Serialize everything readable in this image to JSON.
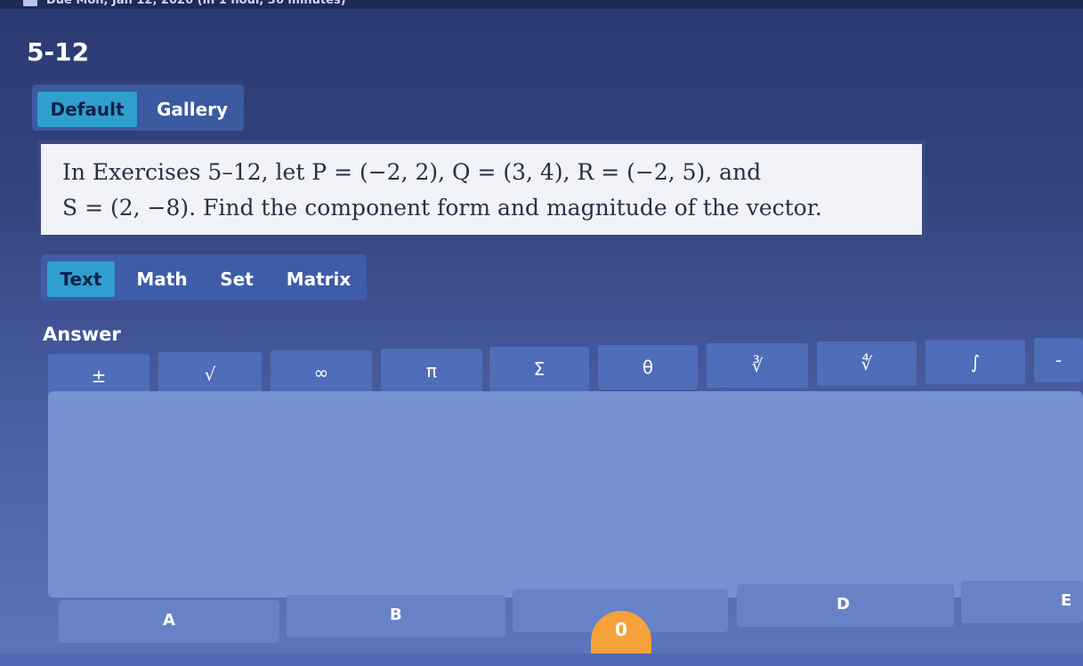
{
  "header": {
    "due_text": "Due Mon, Jan 12, 2026 (in 1 hour, 36 minutes)",
    "title": "5-12"
  },
  "view_tabs": {
    "default": "Default",
    "gallery": "Gallery"
  },
  "question": {
    "text_line1": "In Exercises 5–12, let P = (−2, 2), Q = (3, 4), R = (−2, 5), and",
    "text_line2": "S = (2, −8). Find the component form and magnitude of the vector."
  },
  "mode_tabs": {
    "text": "Text",
    "math": "Math",
    "set": "Set",
    "matrix": "Matrix"
  },
  "answer": {
    "label": "Answer",
    "symbols": [
      "±",
      "√",
      "∞",
      "π",
      "Σ",
      "θ",
      "∛",
      "∜",
      "∫",
      "-"
    ]
  },
  "choices": {
    "labels": [
      "A",
      "B",
      "",
      "D",
      "E"
    ]
  },
  "badge": {
    "count": "0"
  },
  "colors": {
    "accent": "#2f9fcd",
    "badge": "#f5a23a",
    "answer_area": "#7690d4"
  }
}
